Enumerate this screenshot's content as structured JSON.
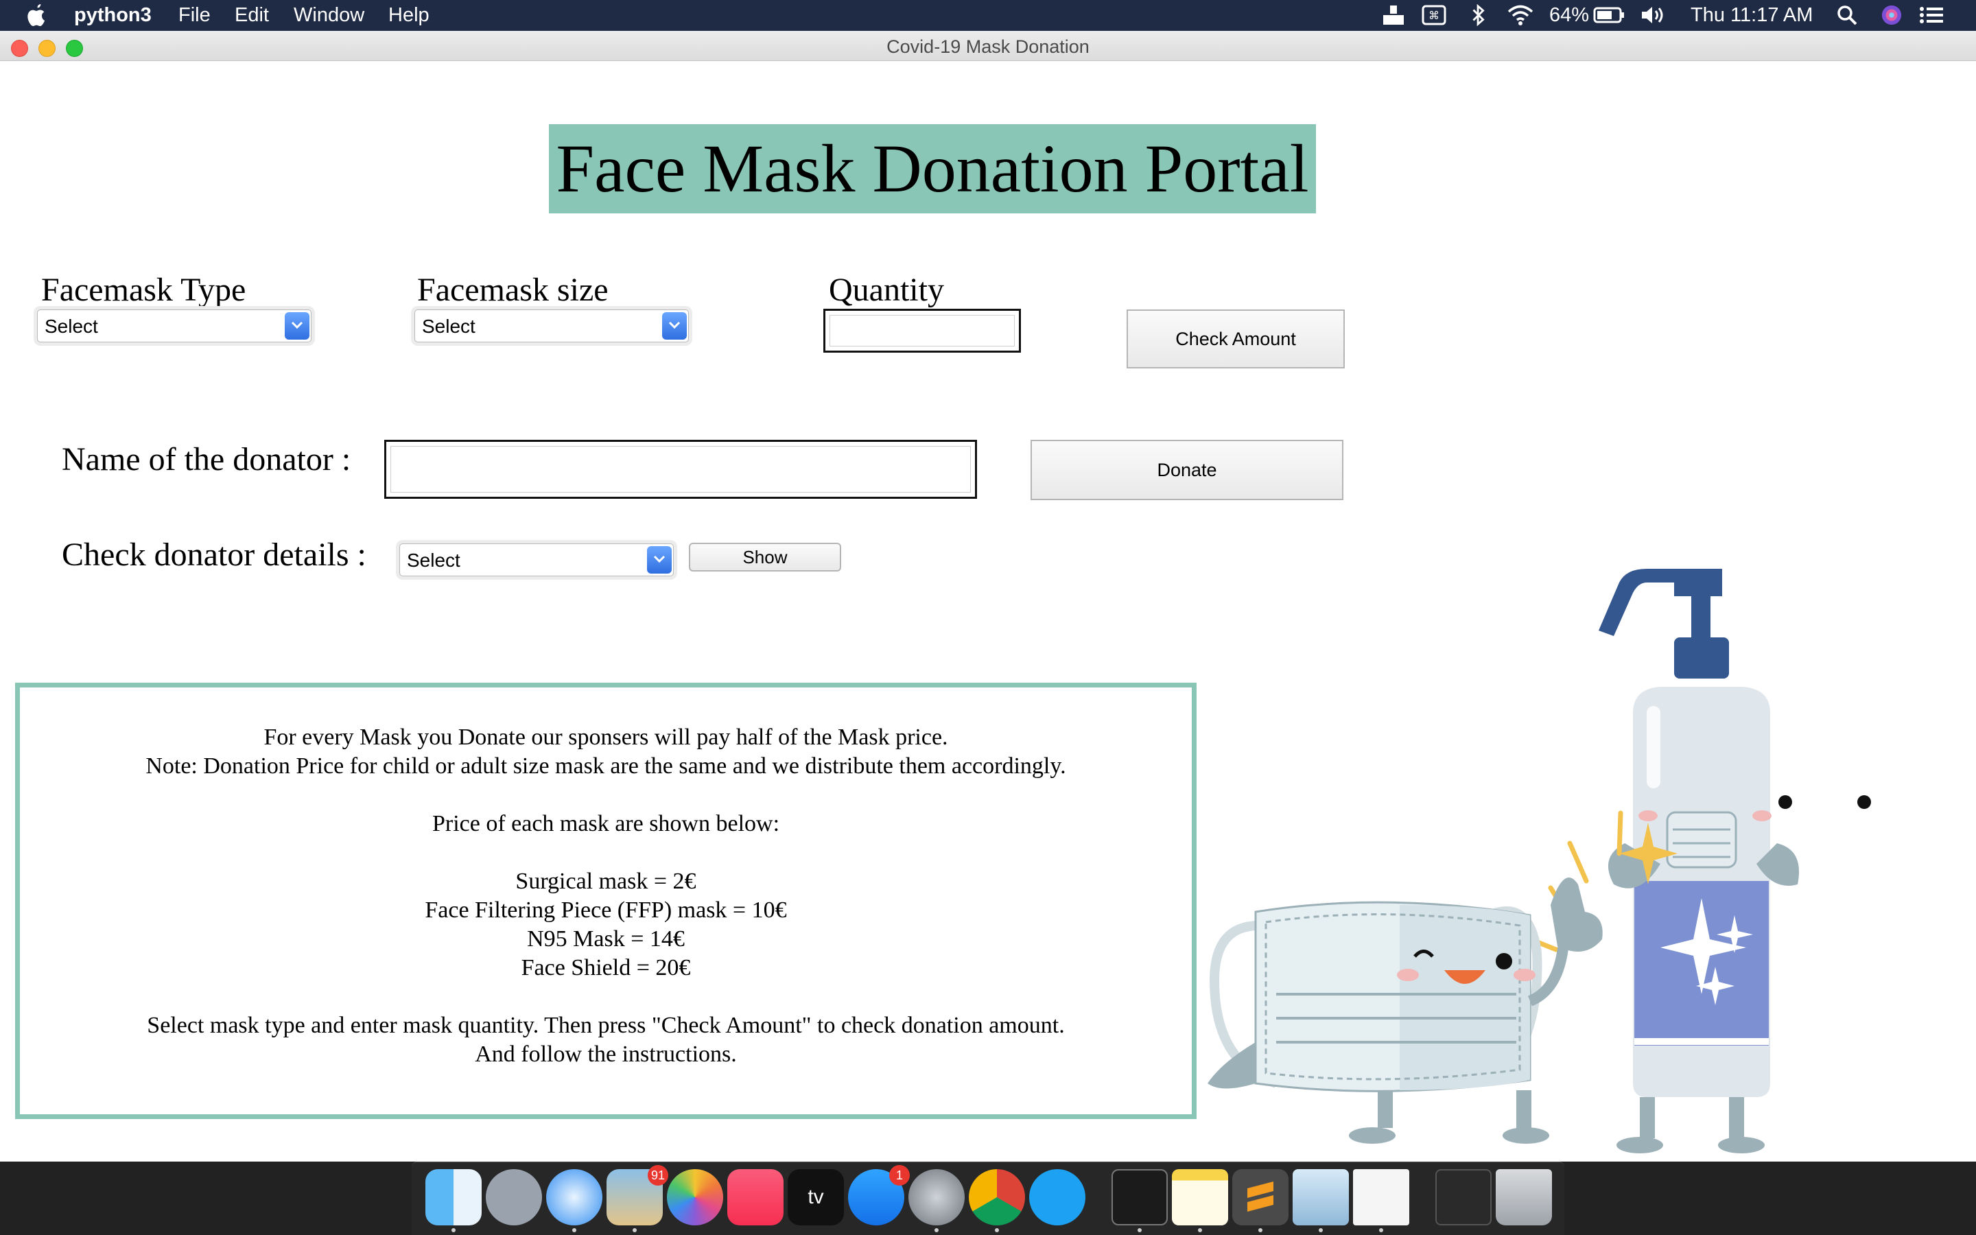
{
  "menubar": {
    "app_name": "python3",
    "menus": [
      "File",
      "Edit",
      "Window",
      "Help"
    ],
    "battery": "64%",
    "clock": "Thu 11:17 AM"
  },
  "window": {
    "title": "Covid-19 Mask Donation"
  },
  "page": {
    "heading": "Face Mask Donation Portal",
    "mask_type": {
      "label": "Facemask Type",
      "selected": "Select"
    },
    "mask_size": {
      "label": "Facemask size",
      "selected": "Select"
    },
    "quantity": {
      "label": "Quantity",
      "value": ""
    },
    "check_amount_label": "Check Amount",
    "donator_name": {
      "label": "Name of the donator :",
      "value": ""
    },
    "donate_label": "Donate",
    "donator_details": {
      "label": "Check donator details :",
      "selected": "Select"
    },
    "show_label": "Show",
    "info_lines": [
      "For every Mask you Donate our sponsers will pay half of the Mask price.",
      "Note: Donation Price for child or adult size mask are the same and we distribute them accordingly.",
      "Price of each mask are shown below:",
      "Surgical mask = 2€",
      "Face Filtering Piece (FFP) mask = 10€",
      "N95 Mask = 14€",
      "Face Shield = 20€",
      "Select mask type and enter mask quantity. Then press \"Check Amount\" to check donation amount.",
      "And follow the instructions."
    ],
    "accent_color": "#8ac6b5"
  },
  "dock": {
    "apps": [
      "finder-icon",
      "launchpad-icon",
      "safari-icon",
      "mail-icon",
      "photos-icon",
      "music-icon",
      "tv-icon",
      "app-store-icon",
      "system-preferences-icon",
      "chrome-icon",
      "skype-icon",
      "terminal-icon",
      "notes-icon",
      "sublime-text-icon",
      "preview-icon",
      "document-icon",
      "stacks-icon",
      "trash-icon"
    ],
    "mail_badge": "91",
    "appstore_badge": "1",
    "tv_label": "tv"
  }
}
